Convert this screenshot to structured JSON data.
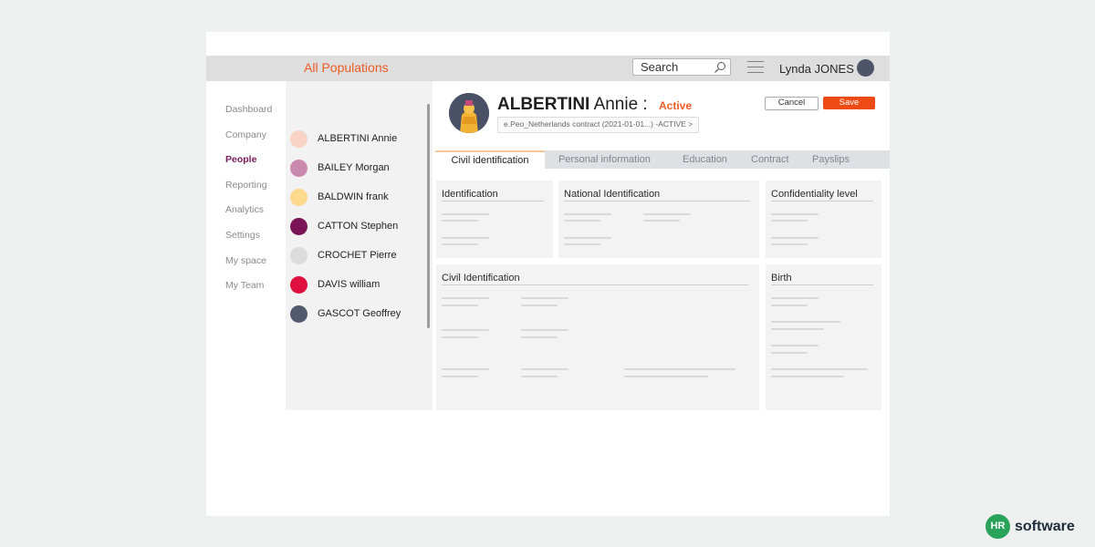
{
  "header": {
    "population": "All Populations",
    "search_text": "Search",
    "username": "Lynda JONES"
  },
  "nav": [
    {
      "label": "Dashboard",
      "active": false
    },
    {
      "label": "Company",
      "active": false
    },
    {
      "label": "People",
      "active": true
    },
    {
      "label": "Reporting",
      "active": false
    },
    {
      "label": "Analytics",
      "active": false
    },
    {
      "label": "Settings",
      "active": false
    },
    {
      "label": "My space",
      "active": false
    },
    {
      "label": "My Team",
      "active": false
    }
  ],
  "people": [
    {
      "name": "ALBERTINI Annie",
      "color": "#f8d3c6"
    },
    {
      "name": "BAILEY Morgan",
      "color": "#c98aae"
    },
    {
      "name": "BALDWIN frank",
      "color": "#fcd98c"
    },
    {
      "name": "CATTON Stephen",
      "color": "#7b1457"
    },
    {
      "name": "CROCHET Pierre",
      "color": "#dcdcdc"
    },
    {
      "name": "DAVIS william",
      "color": "#e0103e"
    },
    {
      "name": "GASCOT Geoffrey",
      "color": "#525a6e"
    }
  ],
  "profile": {
    "last_name": "ALBERTINI",
    "first_name": "Annie :",
    "status": "Active",
    "contract": "e.Peo_Netherlands contract (2021-01-01...) -ACTIVE >",
    "cancel_label": "Cancel",
    "save_label": "Save"
  },
  "tabs": [
    {
      "label": "Civil identification",
      "active": true
    },
    {
      "label": "Personal information",
      "active": false
    },
    {
      "label": "Education",
      "active": false
    },
    {
      "label": "Contract",
      "active": false
    },
    {
      "label": "Payslips",
      "active": false
    }
  ],
  "cards": {
    "identification": "Identification",
    "national_identification": "National Identification",
    "confidentiality": "Confidentiality level",
    "civil_identification": "Civil Identification",
    "birth": "Birth"
  },
  "brand": {
    "mark": "HR",
    "name": "software"
  },
  "colors": {
    "accent": "#ee5b24",
    "save": "#ee4a15",
    "active_nav": "#7a1a5a"
  }
}
